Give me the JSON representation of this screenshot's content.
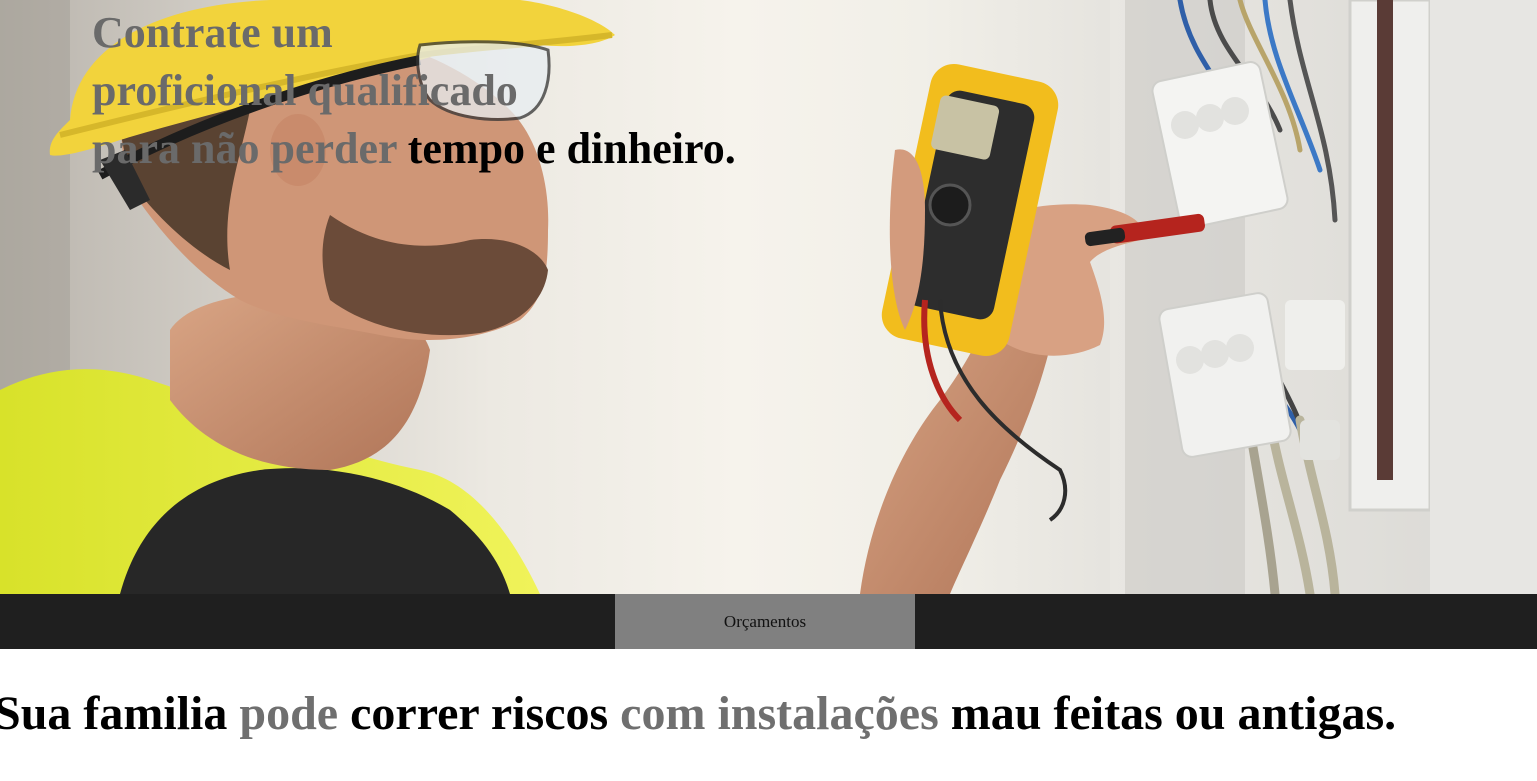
{
  "hero": {
    "image_description_icons": [
      "electrician-photo"
    ],
    "title": {
      "line1": "Contrate um",
      "line2": "proficional qualificado",
      "line3_muted": "para não perder",
      "line3_dark": " tempo e dinheiro."
    }
  },
  "nav": {
    "tabs": [
      {
        "label": "Orçamentos"
      }
    ]
  },
  "headline": {
    "part1": "Sua familia ",
    "part2_muted": "pode",
    "part3": " correr riscos ",
    "part4_muted": "com instalações",
    "part5": " mau feitas ou antigas."
  },
  "colors": {
    "navbar_bg": "#1f1f1f",
    "nav_tab_bg": "#808080",
    "muted_text": "#6a6a6a",
    "helmet_yellow": "#f2d33c",
    "vest_yellow": "#e9ef3a"
  }
}
